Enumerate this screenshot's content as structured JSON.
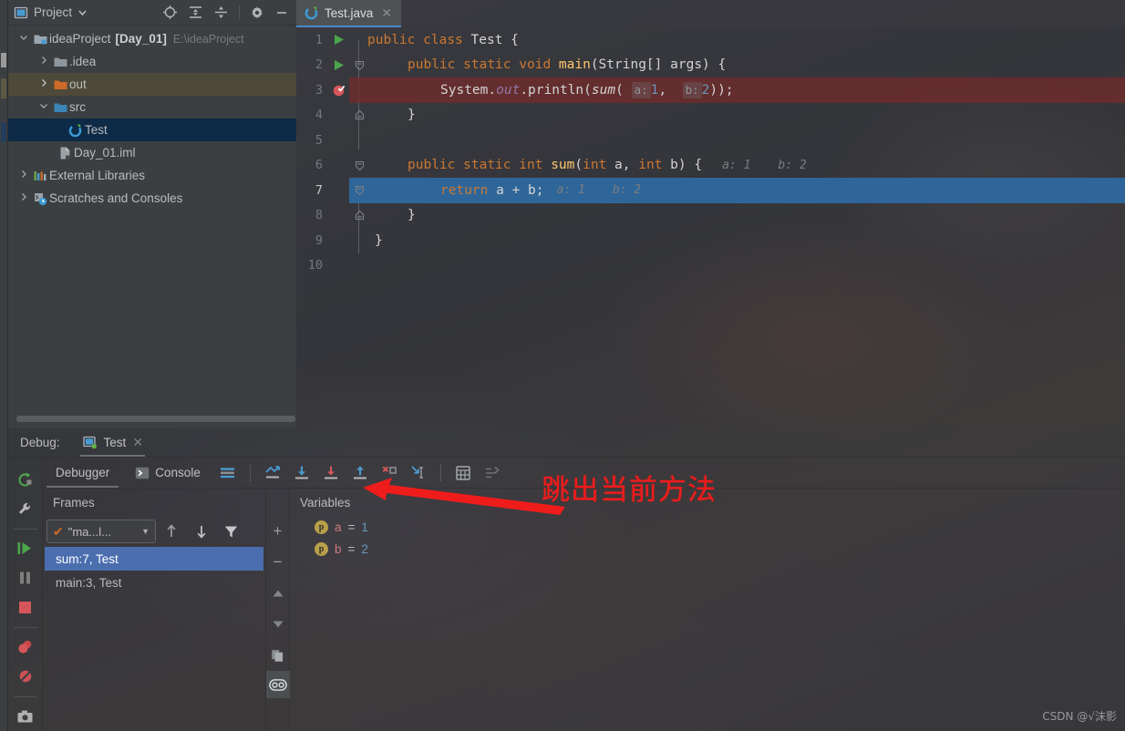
{
  "window": {
    "project_tool_title": "Project",
    "editor_tab": "Test.java",
    "watermark": "CSDN @√沫影"
  },
  "project_panel": {
    "title": "Project",
    "header_icons": [
      "locate-icon",
      "expand-all-icon",
      "collapse-all-icon",
      "gear-icon",
      "minimize-icon"
    ],
    "tree": [
      {
        "name": "ideaProject",
        "bold_suffix": "[Day_01]",
        "path": "E:\\ideaProject",
        "arrow": "down",
        "icon": "module-folder-icon",
        "indent": 0,
        "state": "normal"
      },
      {
        "name": ".idea",
        "bold_suffix": "",
        "path": "",
        "arrow": "right",
        "icon": "folder-grey-icon",
        "indent": 1,
        "state": "normal"
      },
      {
        "name": "out",
        "bold_suffix": "",
        "path": "",
        "arrow": "right",
        "icon": "folder-orange-icon",
        "indent": 1,
        "state": "olive"
      },
      {
        "name": "src",
        "bold_suffix": "",
        "path": "",
        "arrow": "down",
        "icon": "folder-blue-icon",
        "indent": 1,
        "state": "normal"
      },
      {
        "name": "Test",
        "bold_suffix": "",
        "path": "",
        "arrow": "none",
        "icon": "java-class-icon",
        "indent": 2,
        "state": "selected"
      },
      {
        "name": "Day_01.iml",
        "bold_suffix": "",
        "path": "",
        "arrow": "none",
        "icon": "iml-file-icon",
        "indent": 1,
        "state": "normal"
      },
      {
        "name": "External Libraries",
        "bold_suffix": "",
        "path": "",
        "arrow": "right",
        "icon": "libraries-icon",
        "indent": 0,
        "state": "normal"
      },
      {
        "name": "Scratches and Consoles",
        "bold_suffix": "",
        "path": "",
        "arrow": "right",
        "icon": "scratches-icon",
        "indent": 0,
        "state": "normal"
      }
    ]
  },
  "editor": {
    "tab_label": "Test.java",
    "lines": [
      {
        "no": "1",
        "gutter": "run-green-arrow",
        "fold": "none",
        "hl": "none",
        "current": false
      },
      {
        "no": "2",
        "gutter": "run-green-arrow",
        "fold": "collapse",
        "hl": "none",
        "current": false
      },
      {
        "no": "3",
        "gutter": "breakpoint-verified",
        "fold": "none",
        "hl": "red",
        "current": false
      },
      {
        "no": "4",
        "gutter": "none",
        "fold": "end",
        "hl": "none",
        "current": false
      },
      {
        "no": "5",
        "gutter": "none",
        "fold": "none",
        "hl": "none",
        "current": false
      },
      {
        "no": "6",
        "gutter": "none",
        "fold": "collapse",
        "hl": "none",
        "current": false
      },
      {
        "no": "7",
        "gutter": "none",
        "fold": "collapse",
        "hl": "blue",
        "current": true
      },
      {
        "no": "8",
        "gutter": "none",
        "fold": "end",
        "hl": "none",
        "current": false
      },
      {
        "no": "9",
        "gutter": "none",
        "fold": "none",
        "hl": "none",
        "current": false
      },
      {
        "no": "10",
        "gutter": "none",
        "fold": "none",
        "hl": "none",
        "current": false
      }
    ],
    "code_text": {
      "l1": "public class Test {",
      "l2": "public static void main(String[] args) {",
      "l3": "System.out.println(sum( a: 1,  b: 2));",
      "l4": "}",
      "l6": "public static int sum(int a, int b) {",
      "l6_inlay_a": "a: 1",
      "l6_inlay_b": "b: 2",
      "l7": "return a + b;",
      "l7_inlay_a": "a: 1",
      "l7_inlay_b": "b: 2",
      "l8": "}",
      "l9": "}"
    },
    "tokens": {
      "public": "public",
      "class": "class",
      "static": "static",
      "void": "void",
      "int": "int",
      "return": "return",
      "Test": "Test",
      "main": "main",
      "sum": "sum",
      "String_args": "(String[] args) {",
      "System": "System.",
      "out": "out",
      "println": ".println(",
      "sum_italic": "sum",
      "paren_open": "( ",
      "hint_a": "a:",
      "one": "1",
      "comma_sp": ",  ",
      "hint_b": "b:",
      "two": "2",
      "close": "));",
      "brace_open": " {",
      "brace_close": "}",
      "sum_sig": "(int a, int b) {",
      "a_plus_b": " a + b;"
    }
  },
  "debug": {
    "label": "Debug:",
    "session_tab": "Test",
    "session_close": "✕",
    "side_buttons": [
      "rerun-icon",
      "settings-wrench-icon",
      "resume-program-icon",
      "pause-program-icon",
      "stop-icon",
      "view-breakpoints-icon",
      "mute-breakpoints-icon",
      "screenshot-icon"
    ],
    "tabs": [
      {
        "label": "Debugger",
        "icon": "none",
        "active": true
      },
      {
        "label": "Console",
        "icon": "console-icon",
        "active": false
      }
    ],
    "layout_icon": "layout-settings-icon",
    "step_buttons": [
      {
        "name": "show-execution-point-icon",
        "tip": "Show Execution Point"
      },
      {
        "name": "step-over-icon",
        "tip": "Step Over"
      },
      {
        "name": "step-into-icon",
        "tip": "Step Into"
      },
      {
        "name": "step-out-icon",
        "tip": "Step Out"
      },
      {
        "name": "force-step-into-icon",
        "tip": "Force Step Into"
      },
      {
        "name": "run-to-cursor-icon",
        "tip": "Run to Cursor"
      }
    ],
    "extra_buttons": [
      "evaluate-expression-icon",
      "trace-current-stream-icon"
    ],
    "frames": {
      "title": "Frames",
      "thread_label": "\"ma...l...",
      "thread_check": "✔",
      "toolbar_icons": [
        "frame-up-icon",
        "frame-down-icon",
        "filter-icon"
      ],
      "rows": [
        {
          "label": "sum:7, Test",
          "selected": true
        },
        {
          "label": "main:3, Test",
          "selected": false
        }
      ]
    },
    "variables": {
      "title": "Variables",
      "side_buttons": [
        "add-watch-icon",
        "remove-watch-icon",
        "move-up-icon",
        "move-down-icon",
        "copy-icon",
        "inspect-icon"
      ],
      "add_label": "+",
      "remove_label": "−",
      "rows": [
        {
          "badge": "p",
          "name": "a",
          "eq": "=",
          "value": "1"
        },
        {
          "badge": "p",
          "name": "b",
          "eq": "=",
          "value": "2"
        }
      ]
    }
  },
  "annotation": {
    "text": "跳出当前方法",
    "color": "#ef1c1c",
    "arrow": "points-to-step-out-button"
  }
}
